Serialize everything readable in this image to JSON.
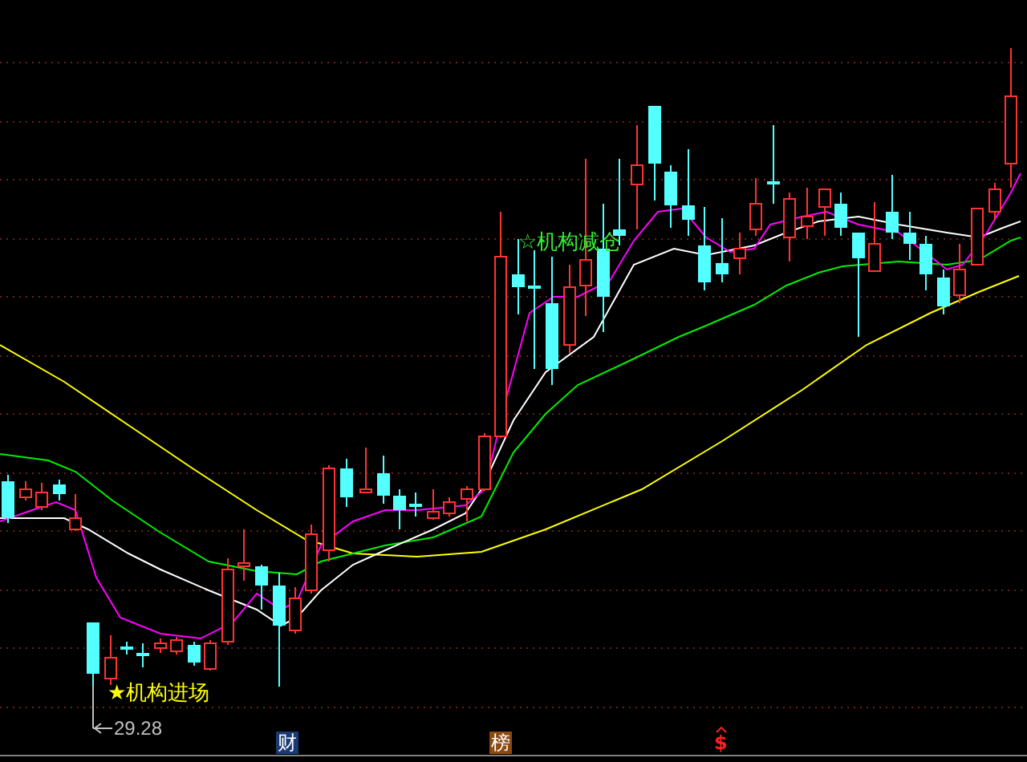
{
  "chart": {
    "annotations": [
      {
        "kind": "buy",
        "text": "★机构进场"
      },
      {
        "kind": "sell",
        "text": "☆机构减仓"
      }
    ],
    "low_marker": "29.28"
  },
  "bottom_markers": [
    {
      "kind": "finance",
      "text": "财"
    },
    {
      "kind": "rank",
      "text": "榜"
    },
    {
      "kind": "dollar",
      "text": "$"
    }
  ]
}
